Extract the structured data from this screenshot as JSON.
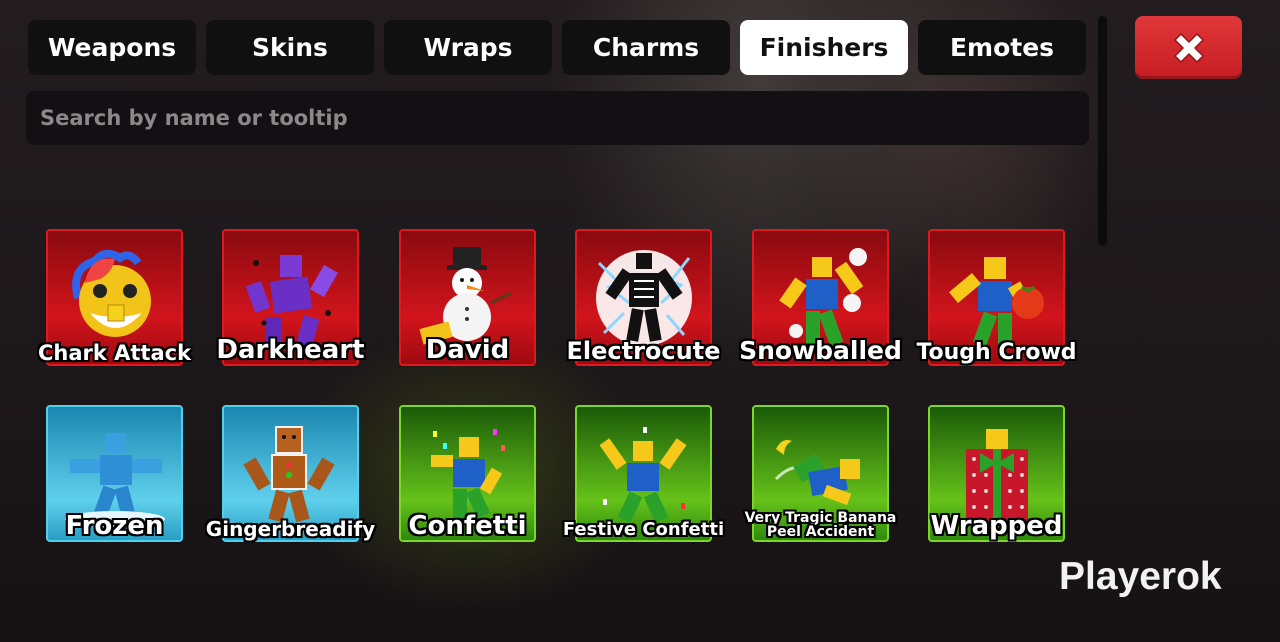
{
  "tabs": [
    {
      "label": "Weapons",
      "active": false
    },
    {
      "label": "Skins",
      "active": false
    },
    {
      "label": "Wraps",
      "active": false
    },
    {
      "label": "Charms",
      "active": false
    },
    {
      "label": "Finishers",
      "active": true
    },
    {
      "label": "Emotes",
      "active": false
    }
  ],
  "close_button": {
    "icon": "close-x-icon",
    "color": "#d42a2e"
  },
  "search": {
    "placeholder": "Search by name or tooltip",
    "value": ""
  },
  "finishers": [
    {
      "name": "Chark Attack",
      "rarity_color": "red",
      "icon": "chark-attack-icon"
    },
    {
      "name": "Darkheart",
      "rarity_color": "red",
      "icon": "darkheart-icon"
    },
    {
      "name": "David",
      "rarity_color": "red",
      "icon": "snowman-icon"
    },
    {
      "name": "Electrocute",
      "rarity_color": "red",
      "icon": "skeleton-lightning-icon"
    },
    {
      "name": "Snowballed",
      "rarity_color": "red",
      "icon": "snowballed-icon"
    },
    {
      "name": "Tough Crowd",
      "rarity_color": "red",
      "icon": "tomato-throw-icon"
    },
    {
      "name": "Frozen",
      "rarity_color": "blue",
      "icon": "frozen-figure-icon"
    },
    {
      "name": "Gingerbreadify",
      "rarity_color": "blue",
      "icon": "gingerbread-icon"
    },
    {
      "name": "Confetti",
      "rarity_color": "green",
      "icon": "confetti-icon"
    },
    {
      "name": "Festive Confetti",
      "rarity_color": "green",
      "icon": "festive-confetti-icon"
    },
    {
      "name": "Very Tragic Banana Peel Accident",
      "rarity_color": "green",
      "icon": "banana-slip-icon"
    },
    {
      "name": "Wrapped",
      "rarity_color": "green",
      "icon": "gift-wrapped-icon"
    }
  ],
  "watermark": "Playerok"
}
